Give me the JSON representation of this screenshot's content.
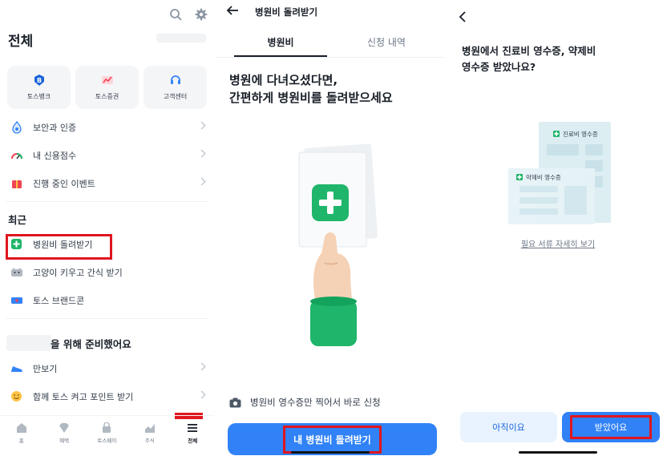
{
  "screen1": {
    "title": "전체",
    "shortcuts": [
      {
        "label": "토스뱅크",
        "icon": "toss-bank-icon"
      },
      {
        "label": "토스증권",
        "icon": "toss-securities-icon"
      },
      {
        "label": "고객센터",
        "icon": "headset-icon"
      }
    ],
    "menu": [
      {
        "label": "보안과 인증",
        "icon": "security-icon"
      },
      {
        "label": "내 신용점수",
        "icon": "credit-gauge-icon"
      },
      {
        "label": "진행 중인 이벤트",
        "icon": "gift-icon"
      }
    ],
    "recent_title": "최근",
    "recent": [
      {
        "label": "병원비 돌려받기",
        "icon": "hospital-plus-icon"
      },
      {
        "label": "고양이 키우고 간식 받기",
        "icon": "cat-icon"
      },
      {
        "label": "토스 브랜드콘",
        "icon": "ticket-icon"
      }
    ],
    "prepared_title": "을 위해 준비했어요",
    "prepared": [
      {
        "label": "만보기",
        "icon": "sneaker-icon"
      },
      {
        "label": "함께 토스 켜고 포인트 받기",
        "icon": "smile-icon"
      }
    ],
    "nav": [
      {
        "label": "홈",
        "icon": "home-icon"
      },
      {
        "label": "혜택",
        "icon": "benefit-icon"
      },
      {
        "label": "토스페이",
        "icon": "shopping-bag-icon"
      },
      {
        "label": "주식",
        "icon": "stock-chart-icon"
      },
      {
        "label": "전체",
        "icon": "menu-icon"
      }
    ],
    "colors": {
      "highlight": "#e0161f",
      "text": "#191f28",
      "sub": "#6b7684"
    }
  },
  "screen2": {
    "title": "병원비 돌려받기",
    "tabs": [
      "병원비",
      "신청 내역"
    ],
    "headline_1": "병원에 다녀오셨다면,",
    "headline_2": "간편하게 병원비를 돌려받으세요",
    "note": "병원비 영수증만 찍어서 바로 신청",
    "cta": "내 병원비 돌려받기",
    "colors": {
      "accent": "#3182f6",
      "hero_green": "#1fb56a"
    }
  },
  "screen3": {
    "question_1": "병원에서 진료비 영수증, 약제비",
    "question_2": "영수증 받았나요?",
    "doc_back_title": "진료비 영수증",
    "doc_front_title": "약제비 영수증",
    "link": "필요 서류 자세히 보기",
    "btn_no": "아직이요",
    "btn_yes": "받았어요",
    "colors": {
      "secondary_bg": "#e8f3ff",
      "secondary_text": "#1b64da",
      "primary": "#3182f6"
    }
  }
}
